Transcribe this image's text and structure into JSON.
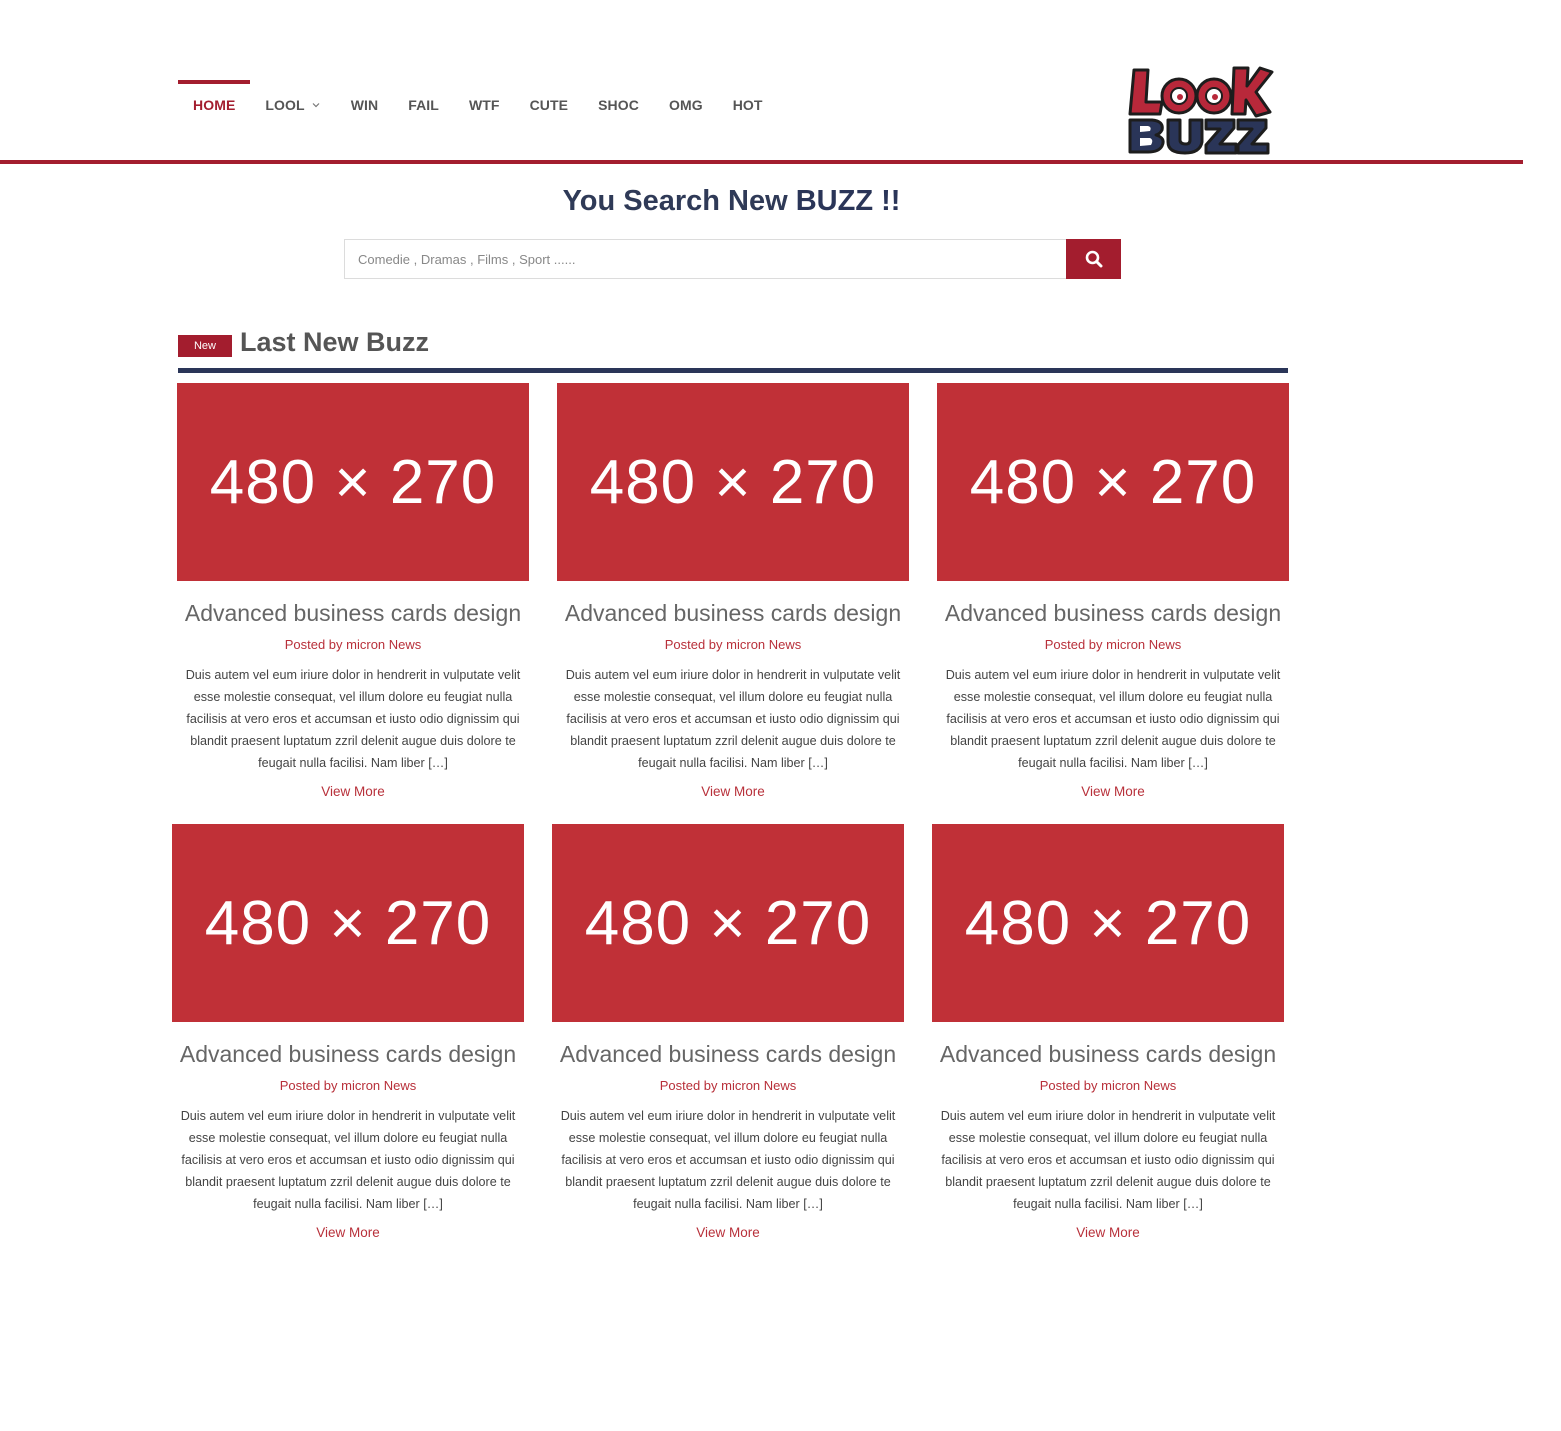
{
  "nav": {
    "items": [
      {
        "label": "HOME",
        "active": true
      },
      {
        "label": "LOOL",
        "has_dropdown": true
      },
      {
        "label": "WIN"
      },
      {
        "label": "FAIL"
      },
      {
        "label": "WTF"
      },
      {
        "label": "CUTE"
      },
      {
        "label": "SHOC"
      },
      {
        "label": "OMG"
      },
      {
        "label": "HOT"
      }
    ]
  },
  "logo": {
    "line1": "LooK",
    "line2": "BUZZ"
  },
  "search": {
    "title_prefix": "You Search New ",
    "title_bold": "BUZZ !!",
    "placeholder": "Comedie , Dramas , Films , Sport ......",
    "button_icon": "search-icon"
  },
  "section": {
    "badge": "New",
    "title": "Last New Buzz"
  },
  "cards": [
    {
      "image_label": "480 × 270",
      "title": "Advanced business cards design",
      "meta": "Posted by micron News",
      "excerpt": "Duis autem vel eum iriure dolor in hendrerit in vulputate velit esse molestie consequat, vel illum dolore eu feugiat nulla facilisis at vero eros et accumsan et iusto odio dignissim qui blandit praesent luptatum zzril delenit augue duis dolore te feugait nulla facilisi. Nam liber […]",
      "more": "View More"
    },
    {
      "image_label": "480 × 270",
      "title": "Advanced business cards design",
      "meta": "Posted by micron News",
      "excerpt": "Duis autem vel eum iriure dolor in hendrerit in vulputate velit esse molestie consequat, vel illum dolore eu feugiat nulla facilisis at vero eros et accumsan et iusto odio dignissim qui blandit praesent luptatum zzril delenit augue duis dolore te feugait nulla facilisi. Nam liber […]",
      "more": "View More"
    },
    {
      "image_label": "480 × 270",
      "title": "Advanced business cards design",
      "meta": "Posted by micron News",
      "excerpt": "Duis autem vel eum iriure dolor in hendrerit in vulputate velit esse molestie consequat, vel illum dolore eu feugiat nulla facilisis at vero eros et accumsan et iusto odio dignissim qui blandit praesent luptatum zzril delenit augue duis dolore te feugait nulla facilisi. Nam liber […]",
      "more": "View More"
    },
    {
      "image_label": "480 × 270",
      "title": "Advanced business cards design",
      "meta": "Posted by micron News",
      "excerpt": "Duis autem vel eum iriure dolor in hendrerit in vulputate velit esse molestie consequat, vel illum dolore eu feugiat nulla facilisis at vero eros et accumsan et iusto odio dignissim qui blandit praesent luptatum zzril delenit augue duis dolore te feugait nulla facilisi. Nam liber […]",
      "more": "View More"
    },
    {
      "image_label": "480 × 270",
      "title": "Advanced business cards design",
      "meta": "Posted by micron News",
      "excerpt": "Duis autem vel eum iriure dolor in hendrerit in vulputate velit esse molestie consequat, vel illum dolore eu feugiat nulla facilisis at vero eros et accumsan et iusto odio dignissim qui blandit praesent luptatum zzril delenit augue duis dolore te feugait nulla facilisi. Nam liber […]",
      "more": "View More"
    },
    {
      "image_label": "480 × 270",
      "title": "Advanced business cards design",
      "meta": "Posted by micron News",
      "excerpt": "Duis autem vel eum iriure dolor in hendrerit in vulputate velit esse molestie consequat, vel illum dolore eu feugiat nulla facilisis at vero eros et accumsan et iusto odio dignissim qui blandit praesent luptatum zzril delenit augue duis dolore te feugait nulla facilisi. Nam liber […]",
      "more": "View More"
    }
  ],
  "colors": {
    "brand_red": "#a31d2e",
    "navy": "#2a3558",
    "thumb_red": "#c03037"
  }
}
